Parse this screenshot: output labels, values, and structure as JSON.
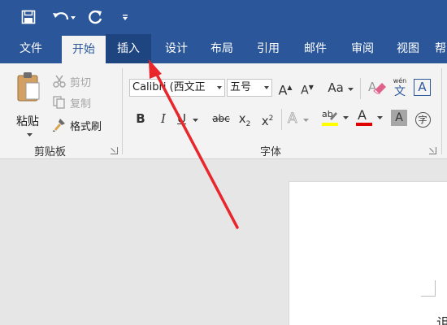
{
  "qat": {
    "save_icon": "save-icon",
    "undo_icon": "undo-icon",
    "redo_icon": "redo-icon",
    "customize_icon": "customize-qat-icon"
  },
  "tabs": [
    {
      "label": "文件"
    },
    {
      "label": "开始"
    },
    {
      "label": "插入"
    },
    {
      "label": "设计"
    },
    {
      "label": "布局"
    },
    {
      "label": "引用"
    },
    {
      "label": "邮件"
    },
    {
      "label": "审阅"
    },
    {
      "label": "视图"
    },
    {
      "label": "帮"
    }
  ],
  "clipboard": {
    "paste_label": "粘贴",
    "cut_label": "剪切",
    "copy_label": "复制",
    "format_painter_label": "格式刷",
    "group_label": "剪贴板"
  },
  "font": {
    "font_name": "Calibri (西文正",
    "font_size": "五号",
    "bold": "B",
    "italic": "I",
    "underline": "U",
    "strikethrough": "abc",
    "subscript_base": "x",
    "subscript_mark": "2",
    "superscript_base": "x",
    "superscript_mark": "2",
    "change_case": "Aa",
    "phonetic_top": "wén",
    "phonetic_char": "文",
    "char_border": "A",
    "highlight_label": "ab",
    "font_color_label": "A",
    "char_shading": "A",
    "enclose_char": "字",
    "grow_font": "A",
    "shrink_font": "A",
    "group_label": "字体"
  },
  "document": {
    "visible_char": "诅"
  },
  "colors": {
    "brand": "#2b579a",
    "highlight": "#ffff00",
    "font_color": "#e00000",
    "arrow": "#e8262b"
  }
}
